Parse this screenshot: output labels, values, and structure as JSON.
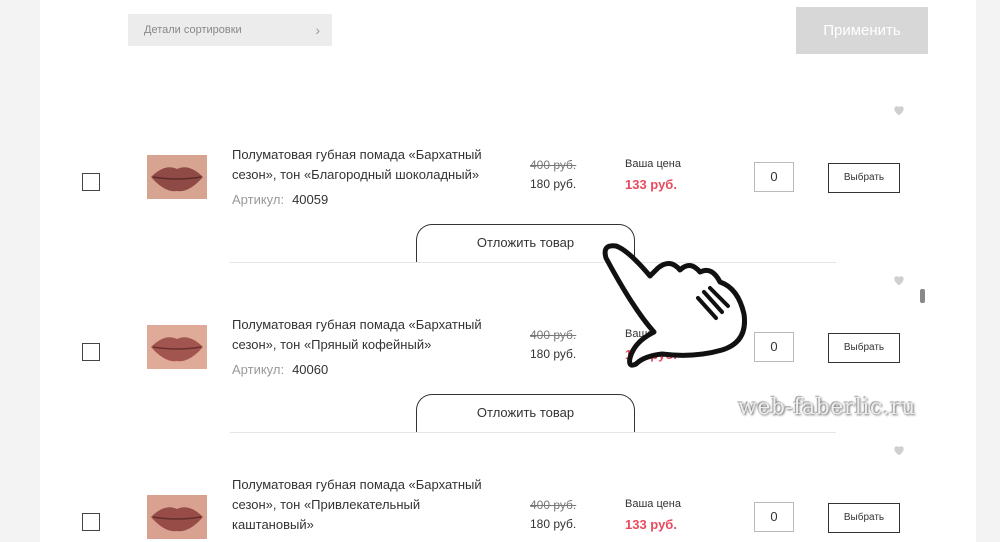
{
  "toolbar": {
    "sort_details_label": "Детали сортировки",
    "apply_label": "Применить"
  },
  "products": [
    {
      "title": "Полуматовая губная помада «Бархатный сезон», тон «Благородный шоколадный»",
      "sku_label": "Артикул:",
      "sku": "40059",
      "old_price": "400 руб.",
      "price": "180 руб.",
      "your_price_label": "Ваша цена",
      "your_price": "133 руб.",
      "qty": "0",
      "choose_label": "Выбрать",
      "defer_label": "Отложить товар"
    },
    {
      "title": "Полуматовая губная помада «Бархатный сезон», тон «Пряный кофейный»",
      "sku_label": "Артикул:",
      "sku": "40060",
      "old_price": "400 руб.",
      "price": "180 руб.",
      "your_price_label": "Ваша цена",
      "your_price": "133 руб.",
      "qty": "0",
      "choose_label": "Выбрать",
      "defer_label": "Отложить товар"
    },
    {
      "title": "Полуматовая губная помада «Бархатный сезон», тон «Привлекательный каштановый»",
      "old_price": "400 руб.",
      "price": "180 руб.",
      "your_price_label": "Ваша цена",
      "your_price": "133 руб.",
      "qty": "0",
      "choose_label": "Выбрать"
    }
  ],
  "watermark": "web-faberlic.ru",
  "colors": {
    "accent_price": "#e84a5f",
    "apply_disabled": "#d7d7d7",
    "lip": "#b85a52"
  },
  "icons": [
    "chevron-right-icon",
    "heart-icon",
    "pointing-hand-icon"
  ]
}
